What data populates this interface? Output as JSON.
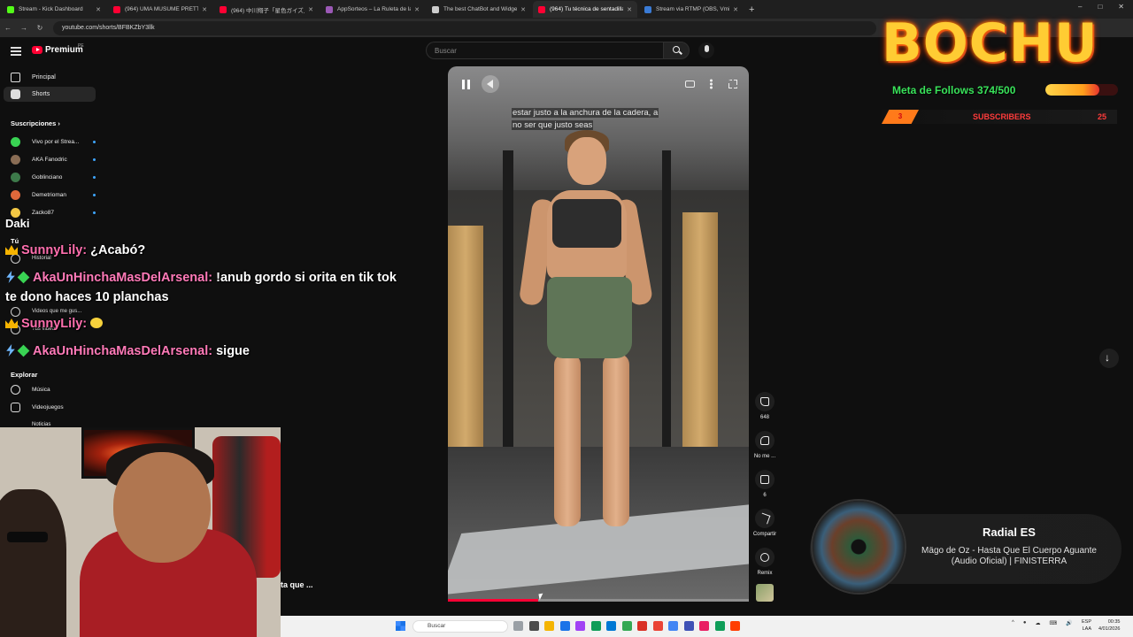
{
  "browser": {
    "tabs": [
      {
        "title": "Stream - Kick Dashboard",
        "color": "#53fc18"
      },
      {
        "title": "(964) UMA MUSUME PRETTY D",
        "color": "#ff0033"
      },
      {
        "title": "(964) 中川翔子「星色ガイズ」～",
        "color": "#ff0033"
      },
      {
        "title": "AppSorteos – La Ruleta de la S",
        "color": "#9b59b6"
      },
      {
        "title": "The best ChatBot and Widgets",
        "color": "#cccccc"
      },
      {
        "title": "(964) Tu técnica de sentadilla si",
        "color": "#ff0033"
      },
      {
        "title": "Stream via RTMP (OBS, Vmix, Z",
        "color": "#3a7bd5"
      }
    ],
    "active_tab_index": 5,
    "url": "youtube.com/shorts/BFBKZbY3llk",
    "window_controls": [
      "–",
      "□",
      "✕"
    ]
  },
  "youtube": {
    "logo_text": "Premium",
    "region_code": "PE",
    "search_placeholder": "Buscar"
  },
  "sidebar": {
    "items": [
      {
        "label": "Principal",
        "icon": "home-icon"
      },
      {
        "label": "Shorts",
        "icon": "shorts-icon"
      }
    ],
    "subscriptions_heading": "Suscripciones",
    "subscriptions": [
      {
        "label": "Vivo por el Strea...",
        "color": "#39d353"
      },
      {
        "label": "AKA Fanodric",
        "color": "#8a6d55"
      },
      {
        "label": "Goblinciano",
        "color": "#3d7a4a"
      },
      {
        "label": "Demetrioman",
        "color": "#e0683b"
      },
      {
        "label": "Zacko87",
        "color": "#f2c744"
      }
    ],
    "you_heading": "Tú",
    "you_items": [
      "Historial",
      "Videos que me gus...",
      "Tus videos"
    ],
    "explore_heading": "Explorar",
    "explore_items": [
      "Música",
      "Videojuegos",
      "Noticias"
    ]
  },
  "chat": {
    "partial_top": "Daki",
    "messages": [
      {
        "user": "SunnyLily:",
        "text": "¿Acabó?",
        "badge": "crown-icon"
      },
      {
        "user": "AkaUnHinchaMasDelArsenal:",
        "text": "!anub gordo si orita en tik tok",
        "badge": "bolt-icon"
      },
      {
        "user": "",
        "text": "te dono haces 10 planchas",
        "badge": ""
      },
      {
        "user": "SunnyLily:",
        "text": "",
        "badge": "crown-icon"
      },
      {
        "user": "AkaUnHinchaMasDelArsenal:",
        "text": "sigue",
        "badge": "bolt-icon"
      }
    ]
  },
  "video": {
    "subtitle_line1": "estar justo a la anchura de la cadera, a",
    "subtitle_line2": "no ser que justo seas",
    "progress": 0.3
  },
  "actions": {
    "like_count": "648",
    "dislike_label": "No me ...",
    "comment_count": "6",
    "share_label": "Compartir",
    "remix_label": "Remix"
  },
  "overlay": {
    "brand": "BOCHU",
    "follow_goal_label": "Meta de Follows 374/500",
    "follow_current": 374,
    "follow_target": 500,
    "subs_count": "3",
    "subs_label": "SUBSCRIBERS",
    "subs_goal": "25"
  },
  "now_playing": {
    "station": "Radial ES",
    "song": "Mägo de Oz - Hasta Que El Cuerpo Aguante (Audio Oficial) | FINISTERRA"
  },
  "webcam": {
    "cut_text": "ta que ..."
  },
  "taskbar": {
    "search_placeholder": "Buscar",
    "apps": [
      "#9aa0a6",
      "#4a4a4a",
      "#f4b400",
      "#1a73e8",
      "#a142f4",
      "#0f9d58",
      "#0078d4",
      "#34a853",
      "#d93025",
      "#ea4335",
      "#4285f4",
      "#3f51b5",
      "#e91e63",
      "#0f9d58",
      "#ff3d00"
    ],
    "tray": [
      "^",
      "●",
      "☁",
      "⌨",
      "🔊"
    ],
    "lang_top": "ESP",
    "lang_bottom": "LAA",
    "time": "00:35",
    "date": "4/01/2026"
  }
}
